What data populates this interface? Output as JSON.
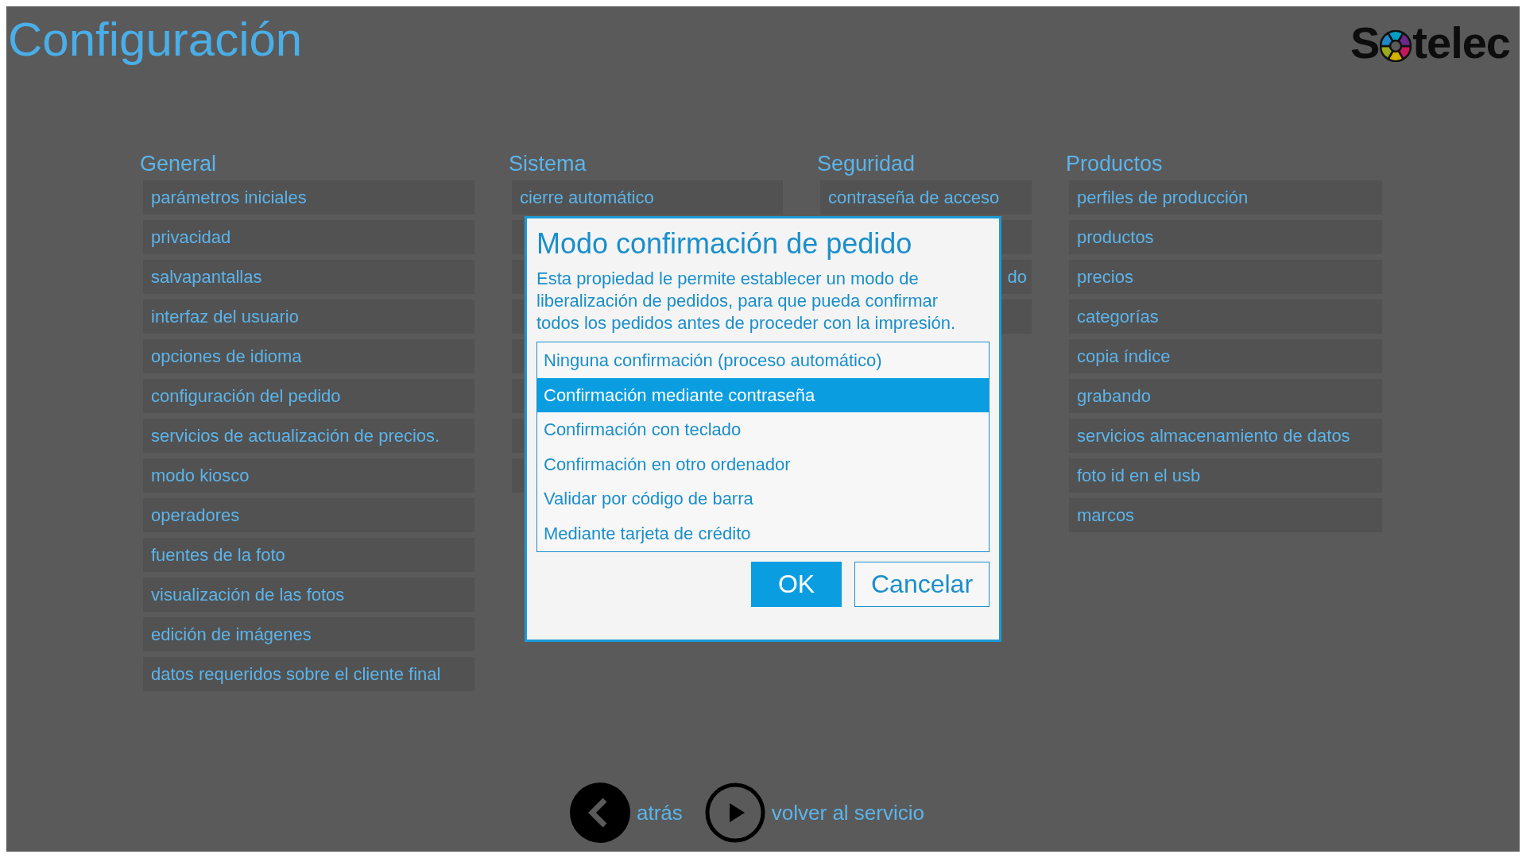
{
  "page": {
    "title": "Configuración"
  },
  "logo": {
    "before": "S",
    "after": "telec"
  },
  "sections": [
    {
      "heading": "General",
      "items": [
        {
          "label": "parámetros iniciales"
        },
        {
          "label": "privacidad"
        },
        {
          "label": "salvapantallas"
        },
        {
          "label": "interfaz del usuario"
        },
        {
          "label": "opciones de idioma"
        },
        {
          "label": "configuración del pedido"
        },
        {
          "label": "servicios de actualización de precios."
        },
        {
          "label": "modo kiosco"
        },
        {
          "label": "operadores"
        },
        {
          "label": "fuentes de la foto"
        },
        {
          "label": "visualización de las fotos"
        },
        {
          "label": "edición de imágenes"
        },
        {
          "label": "datos requeridos sobre el cliente final"
        }
      ]
    },
    {
      "heading": "Sistema",
      "items": [
        {
          "label": "cierre automático"
        },
        {
          "covered_right": true
        },
        {
          "covered_right": true
        },
        {
          "covered_right": true
        },
        {
          "covered_right": true
        },
        {
          "covered_right": true
        },
        {
          "covered_right": true
        },
        {
          "covered_right": true
        }
      ]
    },
    {
      "heading": "Seguridad",
      "items": [
        {
          "label": "contraseña de acceso"
        },
        {
          "covered_left": true
        },
        {
          "label": "do",
          "covered_left": true
        },
        {
          "covered_left": true
        }
      ]
    },
    {
      "heading": "Productos",
      "items": [
        {
          "label": "perfiles de producción"
        },
        {
          "label": "productos"
        },
        {
          "label": "precios"
        },
        {
          "label": "categorías"
        },
        {
          "label": "copia índice"
        },
        {
          "label": "grabando"
        },
        {
          "label": "servicios almacenamiento de datos"
        },
        {
          "label": "foto id en el usb"
        },
        {
          "label": "marcos"
        }
      ]
    }
  ],
  "nav": [
    {
      "kind": "back",
      "label": "atrás"
    },
    {
      "kind": "play",
      "label": "volver al servicio"
    }
  ],
  "dialog": {
    "title": "Modo confirmación de pedido",
    "description": "Esta propiedad le permite establecer un modo de liberalización de pedidos, para que pueda confirmar todos los pedidos antes de proceder con la impresión.",
    "options": [
      {
        "label": "Ninguna confirmación (proceso automático)",
        "selected": false
      },
      {
        "label": "Confirmación mediante contraseña",
        "selected": true
      },
      {
        "label": "Confirmación con teclado",
        "selected": false
      },
      {
        "label": "Confirmación en otro ordenador",
        "selected": false
      },
      {
        "label": "Validar por código de barra",
        "selected": false
      },
      {
        "label": "Mediante tarjeta de crédito",
        "selected": false
      }
    ],
    "buttons": [
      {
        "kind": "primary",
        "label": "OK"
      },
      {
        "kind": "secondary",
        "label": "Cancelar"
      }
    ]
  }
}
